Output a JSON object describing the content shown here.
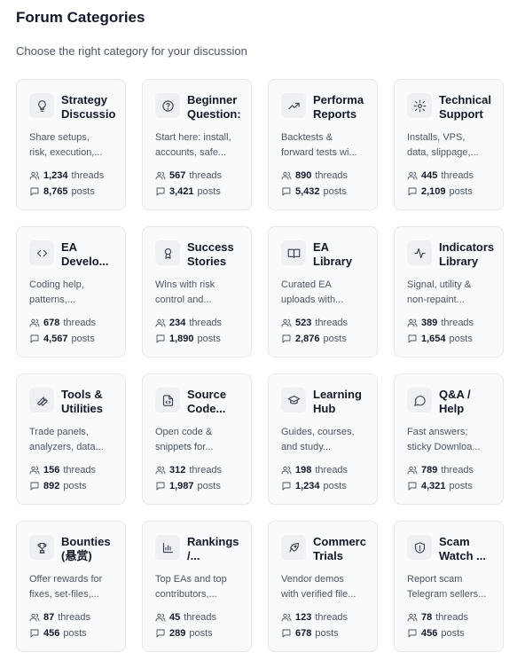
{
  "header": {
    "title": "Forum Categories",
    "subtitle": "Choose the right category for your discussion"
  },
  "categories": [
    {
      "name": "Strategy\nDiscussio",
      "icon": "lightbulb-icon",
      "description": "Share setups,\nrisk, execution,...",
      "threads": "1,234",
      "posts": "8,765"
    },
    {
      "name": "Beginner\nQuestion:",
      "icon": "help-circle-icon",
      "description": "Start here: install,\naccounts, safe...",
      "threads": "567",
      "posts": "3,421"
    },
    {
      "name": "Performa\nReports",
      "icon": "trending-up-icon",
      "description": "Backtests &\nforward tests wi...",
      "threads": "890",
      "posts": "5,432"
    },
    {
      "name": "Technical\nSupport",
      "icon": "gear-icon",
      "description": "Installs, VPS,\ndata, slippage,...",
      "threads": "445",
      "posts": "2,109"
    },
    {
      "name": "EA\nDevelo...",
      "icon": "code-icon",
      "description": "Coding help,\npatterns,...",
      "threads": "678",
      "posts": "4,567"
    },
    {
      "name": "Success\nStories",
      "icon": "award-icon",
      "description": "Wins with risk\ncontrol and...",
      "threads": "234",
      "posts": "1,890"
    },
    {
      "name": "EA\nLibrary",
      "icon": "book-open-icon",
      "description": "Curated EA\nuploads with...",
      "threads": "523",
      "posts": "2,876"
    },
    {
      "name": "Indicators\nLibrary",
      "icon": "activity-icon",
      "description": "Signal, utility &\nnon-repaint...",
      "threads": "389",
      "posts": "1,654"
    },
    {
      "name": "Tools &\nUtilities",
      "icon": "wrench-icon",
      "description": "Trade panels,\nanalyzers, data...",
      "threads": "156",
      "posts": "892"
    },
    {
      "name": "Source\nCode...",
      "icon": "file-code-icon",
      "description": "Open code &\nsnippets for...",
      "threads": "312",
      "posts": "1,987"
    },
    {
      "name": "Learning\nHub",
      "icon": "graduation-cap-icon",
      "description": "Guides, courses,\nand study...",
      "threads": "198",
      "posts": "1,234"
    },
    {
      "name": "Q&A /\nHelp",
      "icon": "message-circle-icon",
      "description": "Fast answers;\nsticky Downloa...",
      "threads": "789",
      "posts": "4,321"
    },
    {
      "name": "Bounties\n(悬赏)",
      "icon": "trophy-icon",
      "description": "Offer rewards for\nfixes, set-files,...",
      "threads": "87",
      "posts": "456"
    },
    {
      "name": "Rankings\n/...",
      "icon": "bar-chart-icon",
      "description": "Top EAs and top\ncontributors,...",
      "threads": "45",
      "posts": "289"
    },
    {
      "name": "Commerc\nTrials",
      "icon": "rocket-icon",
      "description": "Vendor demos\nwith verified file...",
      "threads": "123",
      "posts": "678"
    },
    {
      "name": "Scam\nWatch ...",
      "icon": "shield-alert-icon",
      "description": "Report scam\nTelegram sellers...",
      "threads": "78",
      "posts": "456"
    }
  ],
  "labels": {
    "threads": "threads",
    "posts": "posts"
  }
}
